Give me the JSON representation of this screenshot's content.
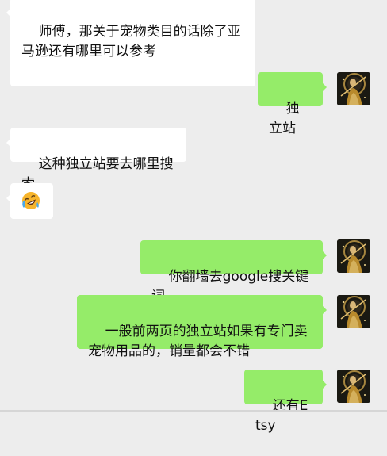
{
  "chat": {
    "messages": [
      {
        "side": "in",
        "text": "师傅，那关于宠物类目的话除了亚马逊还有哪里可以参考"
      },
      {
        "side": "out",
        "text": "独立站"
      },
      {
        "side": "in",
        "text": "这种独立站要去哪里搜索"
      },
      {
        "side": "in",
        "emoji": "laughing-crying-emoji"
      },
      {
        "side": "out",
        "text": "你翻墙去google搜关键词"
      },
      {
        "side": "out",
        "text": "一般前两页的独立站如果有专门卖宠物用品的，销量都会不错"
      },
      {
        "side": "out",
        "text": "还有Etsy"
      }
    ]
  },
  "colors": {
    "background": "#ededed",
    "incoming_bubble": "#ffffff",
    "outgoing_bubble": "#95ec69",
    "text": "#111111"
  }
}
